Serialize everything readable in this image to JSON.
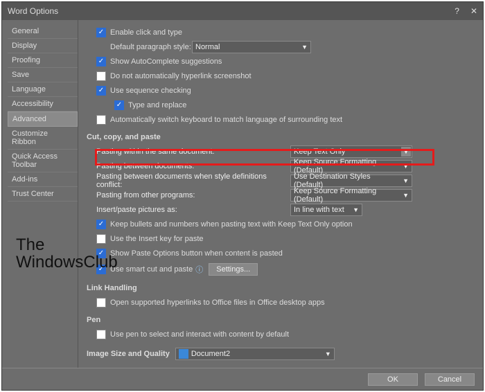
{
  "title": "Word Options",
  "sidebar": {
    "items": [
      {
        "label": "General"
      },
      {
        "label": "Display"
      },
      {
        "label": "Proofing"
      },
      {
        "label": "Save"
      },
      {
        "label": "Language"
      },
      {
        "label": "Accessibility"
      },
      {
        "label": "Advanced",
        "active": true
      },
      {
        "label": "Customize Ribbon"
      },
      {
        "label": "Quick Access Toolbar"
      },
      {
        "label": "Add-ins"
      },
      {
        "label": "Trust Center"
      }
    ]
  },
  "top": {
    "enable_click_and_type": "Enable click and type",
    "default_para_style_lbl": "Default paragraph style:",
    "default_para_style_val": "Normal",
    "show_autocomplete": "Show AutoComplete suggestions",
    "no_auto_hyperlink": "Do not automatically hyperlink screenshot",
    "use_sequence": "Use sequence checking",
    "type_and_replace": "Type and replace",
    "auto_switch": "Automatically switch keyboard to match language of surrounding text"
  },
  "ccp": {
    "header": "Cut, copy, and paste",
    "within_lbl": "Pasting within the same document:",
    "within_val": "Keep Text Only",
    "between_lbl": "Pasting between documents:",
    "between_val": "Keep Source Formatting (Default)",
    "conflict_lbl": "Pasting between documents when style definitions conflict:",
    "conflict_val": "Use Destination Styles (Default)",
    "other_lbl": "Pasting from other programs:",
    "other_val": "Keep Source Formatting (Default)",
    "pics_lbl": "Insert/paste pictures as:",
    "pics_val": "In line with text",
    "keep_bullets": "Keep bullets and numbers when pasting text with Keep Text Only option",
    "insert_key": "Use the Insert key for paste",
    "show_paste_opts": "Show Paste Options button when content is pasted",
    "smart_cut": "Use smart cut and paste",
    "settings_btn": "Settings..."
  },
  "link_handling": {
    "header": "Link Handling",
    "open_supported": "Open supported hyperlinks to Office files in Office desktop apps"
  },
  "pen": {
    "header": "Pen",
    "use_pen": "Use pen to select and interact with content by default"
  },
  "img_q": {
    "header": "Image Size and Quality",
    "doc_val": "Document2"
  },
  "footer": {
    "ok": "OK",
    "cancel": "Cancel"
  },
  "watermark": {
    "line1": "The",
    "line2": "WindowsClub"
  }
}
